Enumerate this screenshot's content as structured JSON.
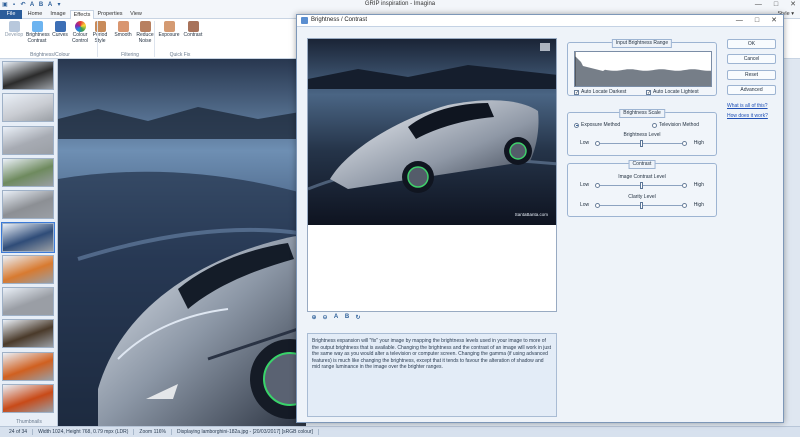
{
  "app": {
    "title": "GRIP inspiration - Imagina",
    "quick_access_icons": [
      "open-icon",
      "save-icon",
      "undo-icon",
      "text-a-icon",
      "text-b-icon",
      "text-c-icon",
      "arrow-icon"
    ],
    "window_buttons": [
      "—",
      "□",
      "✕"
    ]
  },
  "ribbon": {
    "file_tab": "File",
    "tabs": [
      "Home",
      "Image",
      "Effects",
      "Properties",
      "View"
    ],
    "active_tab": "Effects",
    "style_label": "Style ▾",
    "buttons": [
      {
        "label": "Develop",
        "icon": "develop-icon",
        "disabled": true,
        "color": "#b8c8dc"
      },
      {
        "label": "Brightness\nContrast",
        "icon": "brightness-icon",
        "disabled": false,
        "color": "#6db4f0"
      },
      {
        "label": "Curves",
        "icon": "curves-icon",
        "disabled": false,
        "color": "#3d6fb5"
      },
      {
        "label": "Colour\nControl",
        "icon": "colour-wheel-icon",
        "disabled": false,
        "color": "#e25b8c"
      },
      {
        "label": "Period\nStyle",
        "icon": "period-style-icon",
        "disabled": false,
        "color": "#c88b5a"
      },
      {
        "label": "Smooth",
        "icon": "smooth-icon",
        "disabled": false,
        "color": "#d99670"
      },
      {
        "label": "Reduce\nNoise",
        "icon": "reduce-noise-icon",
        "disabled": false,
        "color": "#b88060"
      },
      {
        "label": "Exposure",
        "icon": "exposure-icon",
        "disabled": false,
        "color": "#d49a72"
      },
      {
        "label": "Contrast",
        "icon": "contrast-icon",
        "disabled": false,
        "color": "#a8725a"
      }
    ],
    "groups": [
      "Brightness/Colour",
      "Filtering",
      "Quick Fix"
    ]
  },
  "thumbnails": {
    "label": "Thumbnails",
    "items": [
      {
        "name": "black-car-thumb",
        "color": "#2b2b2b"
      },
      {
        "name": "white-car-thumb",
        "color": "#c9ccd2"
      },
      {
        "name": "silver-car-thumb",
        "color": "#a7abb3"
      },
      {
        "name": "green-car-thumb",
        "color": "#6e8a5e"
      },
      {
        "name": "grey-car-thumb",
        "color": "#8c8f94"
      },
      {
        "name": "supercar-blue-thumb",
        "color": "#2f4c78"
      },
      {
        "name": "sunset-road-thumb",
        "color": "#d87a30"
      },
      {
        "name": "city-car-thumb",
        "color": "#9a9ea5"
      },
      {
        "name": "dream-text-thumb",
        "color": "#4a3a2a"
      },
      {
        "name": "fire-thumb",
        "color": "#d06020"
      },
      {
        "name": "flame-figure-thumb",
        "color": "#c84a18"
      }
    ]
  },
  "status": {
    "items": [
      "24 of 34",
      "Width 1024, Height 768, 0.79 mpx (LDR)",
      "Zoom 116%",
      "Displaying lamborghini-182a.jpg - [20/03/2017] [sRGB colour]"
    ]
  },
  "dialog": {
    "title": "Brightness / Contrast",
    "watermark": "SantaBanta.com",
    "preview_tools": [
      "zoom-in-icon",
      "zoom-out-icon",
      "text-a-icon",
      "text-b-icon",
      "refresh-icon"
    ],
    "description": "Brightness expansion will \"fix\" your image by mapping the brightness levels used in your image to more of the output brightness that is available. Changing the brightness and the contrast of an image will work in just the same way as you would alter a television or computer screen. Changing the gamma (if using advanced features) is much like changing the brightness, except that it tends to favour the alteration of shadow and mid range luminance in the image over the brighter ranges.",
    "input_brightness": {
      "title": "Input Brightness Range",
      "auto_darkest": "Auto Locate Darkest",
      "auto_lightest": "Auto Locate Lightest",
      "auto_darkest_checked": true,
      "auto_lightest_checked": true
    },
    "brightness_scale": {
      "title": "Brightness Scale",
      "option_exposure": "Exposure Method",
      "option_television": "Television Method",
      "selected": "Exposure Method",
      "level_label": "Brightness Level",
      "low": "Low",
      "high": "High",
      "value": 0.5
    },
    "contrast": {
      "title": "Contrast",
      "contrast_label": "Image Contrast Level",
      "clarity_label": "Clarity Level",
      "low": "Low",
      "high": "High",
      "contrast_value": 0.5,
      "clarity_value": 0.5
    },
    "buttons": {
      "ok": "OK",
      "cancel": "Cancel",
      "reset": "Reset",
      "advanced": "Advanced"
    },
    "links": {
      "what": "What is all of this?",
      "how": "How does it work?"
    }
  }
}
